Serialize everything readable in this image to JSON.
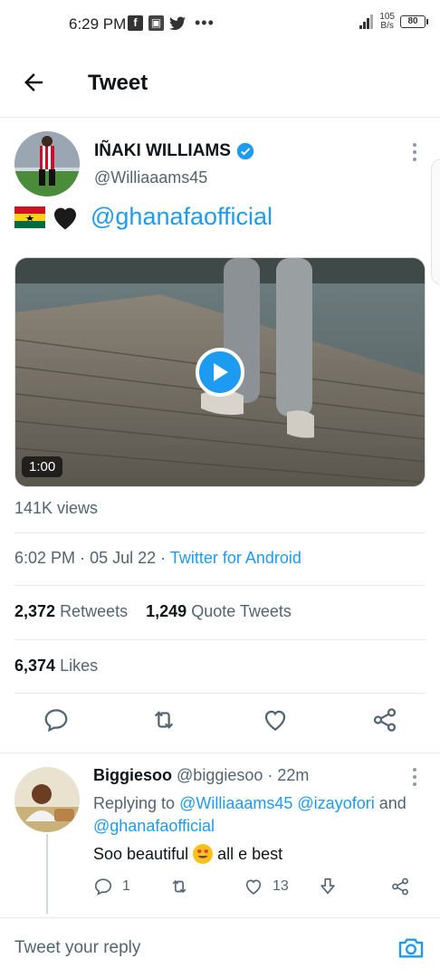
{
  "status_bar": {
    "time": "6:29 PM",
    "net_speed_value": "105",
    "net_speed_unit": "B/s",
    "battery": "80"
  },
  "header": {
    "title": "Tweet"
  },
  "tweet": {
    "author_name": "IÑAKI WILLIAMS",
    "author_handle": "@Williaaams45",
    "text_mention": "@ghanafaofficial",
    "video_duration": "1:00",
    "views": "141K views",
    "time": "6:02 PM",
    "date": "05 Jul 22",
    "client": "Twitter for Android",
    "retweets_count": "2,372",
    "retweets_label": "Retweets",
    "quotes_count": "1,249",
    "quotes_label": "Quote Tweets",
    "likes_count": "6,374",
    "likes_label": "Likes"
  },
  "reply": {
    "name": "Biggiesoo",
    "handle": "@biggiesoo",
    "age": "22m",
    "replying_prefix": "Replying to",
    "replying_to_1": "@Williaaams45",
    "replying_to_2": "@izayofori",
    "replying_and": "and",
    "replying_to_3": "@ghanafaofficial",
    "text_before": "Soo beautiful",
    "text_after": "all e best",
    "reply_count": "1",
    "like_count": "13"
  },
  "composer": {
    "placeholder": "Tweet your reply"
  },
  "colors": {
    "accent": "#1d9bf0",
    "secondary_text": "#536471",
    "divider": "#e7e9ea"
  }
}
